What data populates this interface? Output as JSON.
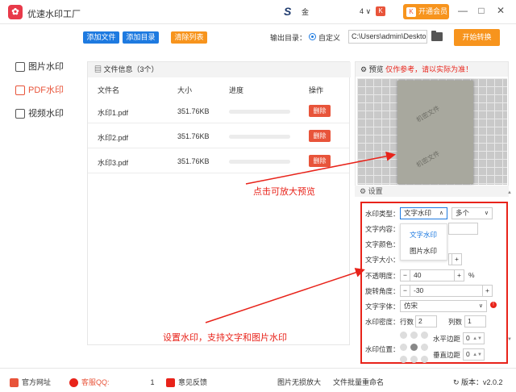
{
  "app": {
    "title": "优速水印工厂",
    "logo_char": "✿",
    "user_name": "金",
    "count": "4"
  },
  "titlebar": {
    "vip_label": "开通会员",
    "minimize": "—",
    "maximize": "□",
    "close": "✕"
  },
  "toolbar": {
    "add_file": "添加文件",
    "add_dir": "添加目录",
    "clear_list": "清除列表",
    "output_label": "输出目录：",
    "custom_label": "自定义",
    "output_path": "C:\\Users\\admin\\Deskto",
    "start": "开始转换"
  },
  "sidebar": {
    "items": [
      {
        "label": "图片水印",
        "active": false
      },
      {
        "label": "PDF水印",
        "active": true
      },
      {
        "label": "视频水印",
        "active": false
      }
    ]
  },
  "files": {
    "header": "文件信息（3个）",
    "columns": [
      "文件名",
      "大小",
      "进度",
      "操作"
    ],
    "rows": [
      {
        "name": "水印1.pdf",
        "size": "351.76KB",
        "action": "删除"
      },
      {
        "name": "水印2.pdf",
        "size": "351.76KB",
        "action": "删除"
      },
      {
        "name": "水印3.pdf",
        "size": "351.76KB",
        "action": "删除"
      }
    ]
  },
  "preview": {
    "label": "预览",
    "note": "仅作参考，请以实际为准！",
    "watermark_text": "机密文件"
  },
  "settings": {
    "header": "设置",
    "type_label": "水印类型：",
    "type_value": "文字水印",
    "type_options": [
      "文字水印",
      "图片水印"
    ],
    "multi_value": "多个",
    "content_label": "文字内容：",
    "color_label": "文字颜色：",
    "size_label": "文字大小：",
    "opacity_label": "不透明度：",
    "opacity_value": "40",
    "opacity_unit": "%",
    "rotation_label": "旋转角度：",
    "rotation_value": "-30",
    "font_label": "文字字体：",
    "font_value": "仿宋",
    "density_label": "水印密度：",
    "rows_label": "行数",
    "rows_value": "2",
    "cols_label": "列数",
    "cols_value": "1",
    "position_label": "水印位置：",
    "hmargin_label": "水平边距",
    "hmargin_value": "0",
    "vmargin_label": "垂直边距",
    "vmargin_value": "0"
  },
  "annotations": {
    "preview_tip": "点击可放大预览",
    "settings_tip": "设置水印，支持文字和图片水印"
  },
  "bottombar": {
    "website": "官方网址",
    "qq_label": "客服QQ:",
    "qq_value": "1",
    "feedback": "意见反馈",
    "pic_enlarge": "图片无损放大",
    "rename": "文件批量重命名",
    "version": "版本：v2.0.2"
  },
  "colors": {
    "accent": "#f7941d",
    "blue_button": "#1e7ae0",
    "danger": "#e8543a",
    "annotation": "#e8231a"
  }
}
